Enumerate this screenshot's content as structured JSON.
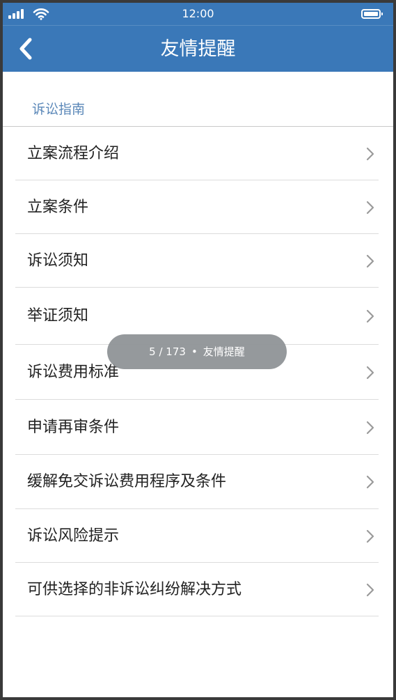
{
  "status_bar": {
    "time": "12:00",
    "signal_icon": "signal-bars-icon",
    "wifi_icon": "wifi-icon",
    "battery_icon": "battery-icon"
  },
  "nav": {
    "title": "友情提醒",
    "back_icon": "chevron-left-icon"
  },
  "section": {
    "title": "诉讼指南"
  },
  "items": [
    {
      "label": "立案流程介绍"
    },
    {
      "label": "立案条件"
    },
    {
      "label": "诉讼须知"
    },
    {
      "label": "举证须知"
    },
    {
      "label": "诉讼费用标准"
    },
    {
      "label": "申请再审条件"
    },
    {
      "label": "缓解免交诉讼费用程序及条件"
    },
    {
      "label": "诉讼风险提示"
    },
    {
      "label": "可供选择的非诉讼纠纷解决方式"
    }
  ],
  "toast": {
    "page": "5 / 173",
    "separator": "•",
    "label": "友情提醒"
  },
  "colors": {
    "header": "#3a78b8",
    "section_title": "#5a87b8",
    "divider": "#dcdcdc",
    "chevron": "#9a9a9a",
    "frame": "#3a3a3a"
  }
}
